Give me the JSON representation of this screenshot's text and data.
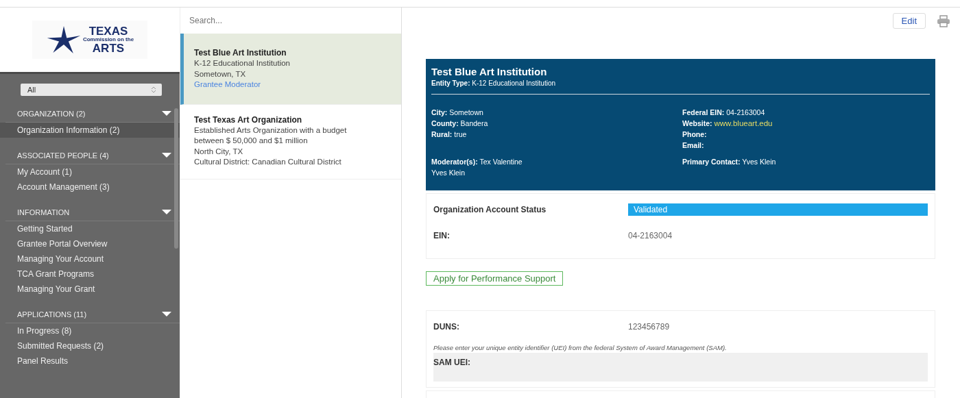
{
  "logo": {
    "line_1": "TEXAS",
    "line_2": "Commission on the",
    "line_3": "ARTS"
  },
  "filter": {
    "value": "All"
  },
  "nav_groups": [
    {
      "title": "ORGANIZATION (2)",
      "items": [
        {
          "label": "Organization Information  (2)",
          "selected": true
        }
      ]
    },
    {
      "title": "ASSOCIATED PEOPLE (4)",
      "items": [
        {
          "label": "My Account  (1)",
          "selected": false
        },
        {
          "label": "Account Management  (3)",
          "selected": false
        }
      ]
    },
    {
      "title": "INFORMATION",
      "items": [
        {
          "label": "Getting Started",
          "selected": false
        },
        {
          "label": "Grantee Portal Overview",
          "selected": false
        },
        {
          "label": "Managing Your Account",
          "selected": false
        },
        {
          "label": "TCA Grant Programs",
          "selected": false
        },
        {
          "label": "Managing Your Grant",
          "selected": false
        }
      ]
    },
    {
      "title": "APPLICATIONS (11)",
      "items": [
        {
          "label": "In Progress  (8)",
          "selected": false
        },
        {
          "label": "Submitted Requests  (2)",
          "selected": false
        },
        {
          "label": "Panel Results",
          "selected": false
        }
      ]
    }
  ],
  "search": {
    "placeholder": "Search..."
  },
  "organizations": [
    {
      "name": "Test Blue Art Institution",
      "lines": [
        "K-12 Educational Institution",
        "Sometown, TX"
      ],
      "role": "Grantee Moderator",
      "selected": true
    },
    {
      "name": "Test Texas Art Organization",
      "lines": [
        "Established Arts Organization with a budget between $ 50,000 and $1 million",
        "North City, TX",
        "Cultural District: Canadian Cultural District"
      ],
      "selected": false
    }
  ],
  "toolbar": {
    "edit": "Edit"
  },
  "header": {
    "title": "Test Blue Art Institution",
    "subtitle": "**Entity Type:** K-12 Educational Institution",
    "left": [
      "**City:** Sometown",
      "**County:** Bandera",
      "**Rural:** true"
    ],
    "right": [
      {
        "label": "Federal EIN:",
        "value": "04-2163004"
      },
      {
        "label": "Website:",
        "value": "www.blueart.edu",
        "link": true
      },
      {
        "label": "Phone:"
      },
      {
        "label": "Email:"
      }
    ],
    "moderators_label": "Moderator(s):",
    "moderators": [
      "Tex Valentine",
      "Yves Klein"
    ],
    "primary_contact": "**Primary Contact:** Yves Klein"
  },
  "status": {
    "label": "Organization Account Status",
    "value": "Validated"
  },
  "ein": {
    "label": "EIN:",
    "value": "04-2163004"
  },
  "apply_button": "Apply for Performance Support",
  "duns": {
    "label": "DUNS:",
    "value": "123456789"
  },
  "sam": {
    "hint": "Please enter your unique entity identifier (UEI) from the federal System of Award Management (SAM).",
    "label": "SAM UEI:"
  }
}
